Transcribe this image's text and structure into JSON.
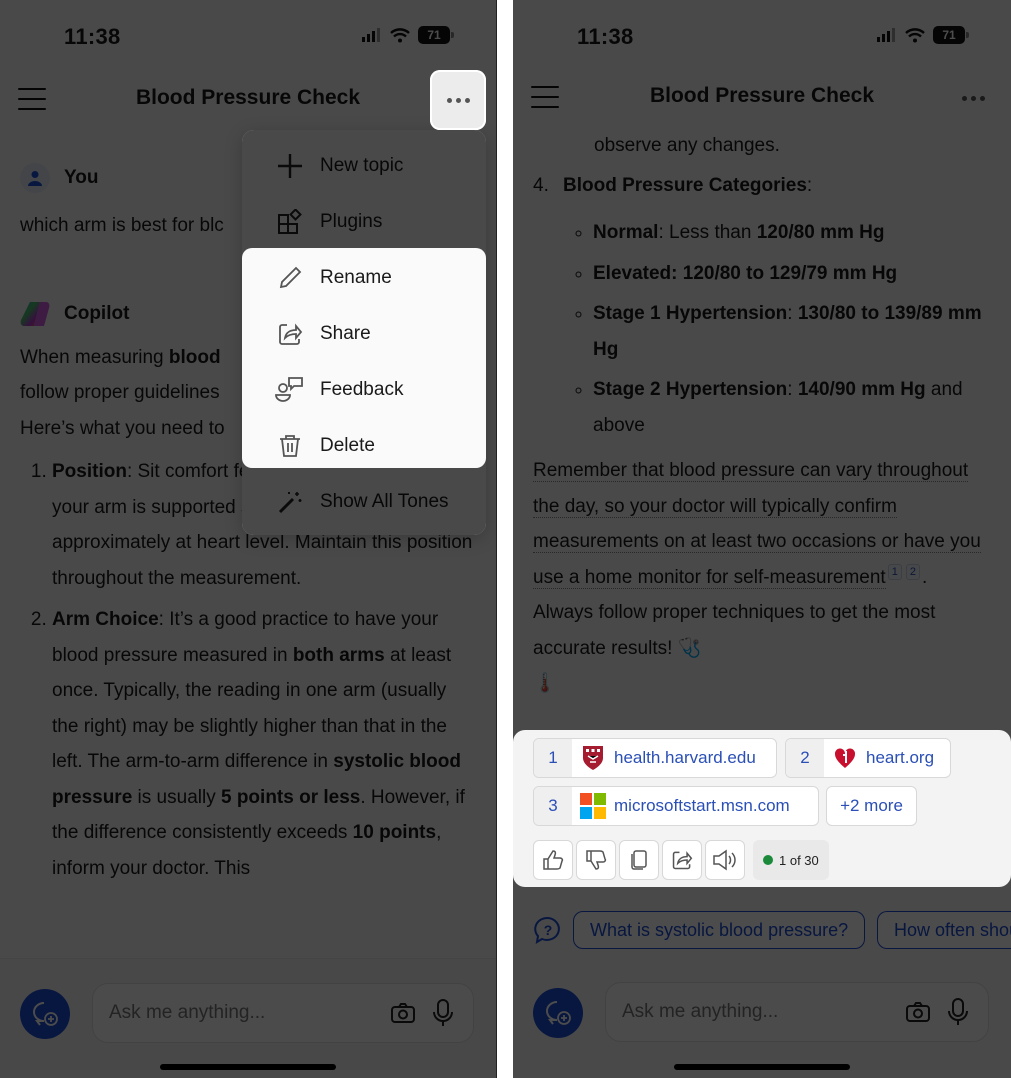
{
  "status": {
    "time": "11:38",
    "battery": "71"
  },
  "header": {
    "title": "Blood Pressure Check",
    "menu_icon": "hamburger-icon",
    "more_icon": "more-dots-icon"
  },
  "left": {
    "user": {
      "name": "You",
      "message": "which arm is best for blc"
    },
    "bot": {
      "name": "Copilot",
      "intro_1": "When measuring ",
      "intro_bold": "blood ",
      "intro_2": "follow proper guidelines",
      "intro_3": "Here’s what you need to",
      "items": [
        {
          "bold": "Position",
          "text": ": Sit comfort",
          "cont": "feet on the floor. Ensure your arm is supported so that your elbow is approximately at heart level. Maintain this position throughout the measurement."
        },
        {
          "bold": "Arm Choice",
          "text": ": It’s a good practice to have your blood pressure measured in ",
          "bold2": "both arms",
          "text2": " at least once. Typically, the reading in one arm (usually the right) may be slightly higher than that in the left. The arm-to-arm difference in ",
          "bold3": "systolic blood pressure",
          "text3": " is usually ",
          "bold4": "5 points or less",
          "text4": ". However, if the difference consistently exceeds ",
          "bold5": "10 points",
          "text5": ", inform your doctor. This"
        }
      ]
    },
    "menu": [
      {
        "label": "New topic",
        "icon": "plus-icon"
      },
      {
        "label": "Plugins",
        "icon": "plugins-icon"
      },
      {
        "label": "Rename",
        "icon": "pencil-icon"
      },
      {
        "label": "Share",
        "icon": "share-icon"
      },
      {
        "label": "Feedback",
        "icon": "feedback-icon"
      },
      {
        "label": "Delete",
        "icon": "trash-icon"
      },
      {
        "label": "Show All Tones",
        "icon": "magic-wand-icon"
      }
    ]
  },
  "right": {
    "top_line": "observe any changes.",
    "item4": {
      "number": "4.",
      "bold": "Blood Pressure Categories",
      "tail": ":"
    },
    "categories": [
      {
        "bold": "Normal",
        "text": ": Less than ",
        "bold2": "120/80 mm Hg",
        "text2": ""
      },
      {
        "bold": "Elevated: 120/80 to 129/79 mm Hg",
        "text": "",
        "bold2": "",
        "text2": ""
      },
      {
        "bold": "Stage 1 Hypertension",
        "text": ": ",
        "bold2": "130/80 to 139/89 mm Hg",
        "text2": ""
      },
      {
        "bold": "Stage 2 Hypertension",
        "text": ": ",
        "bold2": "140/90 mm Hg",
        "text2": " and above"
      }
    ],
    "remember": "Remember that blood pressure can vary throughout the day, so your doctor will typically confirm measurements on at least two occasions or have you use a home monitor for self-measurement",
    "cite1": "1",
    "cite2": "2",
    "closing": ". Always follow proper techniques to get the most accurate results! ",
    "emoji_1": "🩺",
    "emoji_2": "🌡️",
    "sources": [
      {
        "num": "1",
        "domain": "health.harvard.edu",
        "logo": "harvard-shield-icon"
      },
      {
        "num": "2",
        "domain": "heart.org",
        "logo": "heart-org-icon"
      },
      {
        "num": "3",
        "domain": "microsoftstart.msn.com",
        "logo": "microsoft-logo-icon"
      }
    ],
    "more_sources": "+2 more",
    "actions": [
      "thumbs-up-icon",
      "thumbs-down-icon",
      "copy-icon",
      "share-icon",
      "speaker-icon"
    ],
    "counter": "1 of 30",
    "suggestions": [
      "What is systolic blood pressure?",
      "How often should"
    ]
  },
  "input": {
    "placeholder": "Ask me anything..."
  },
  "colors": {
    "accent": "#1d4ed8",
    "status_dot": "#1a8a3a",
    "link": "#2a4fb6"
  }
}
